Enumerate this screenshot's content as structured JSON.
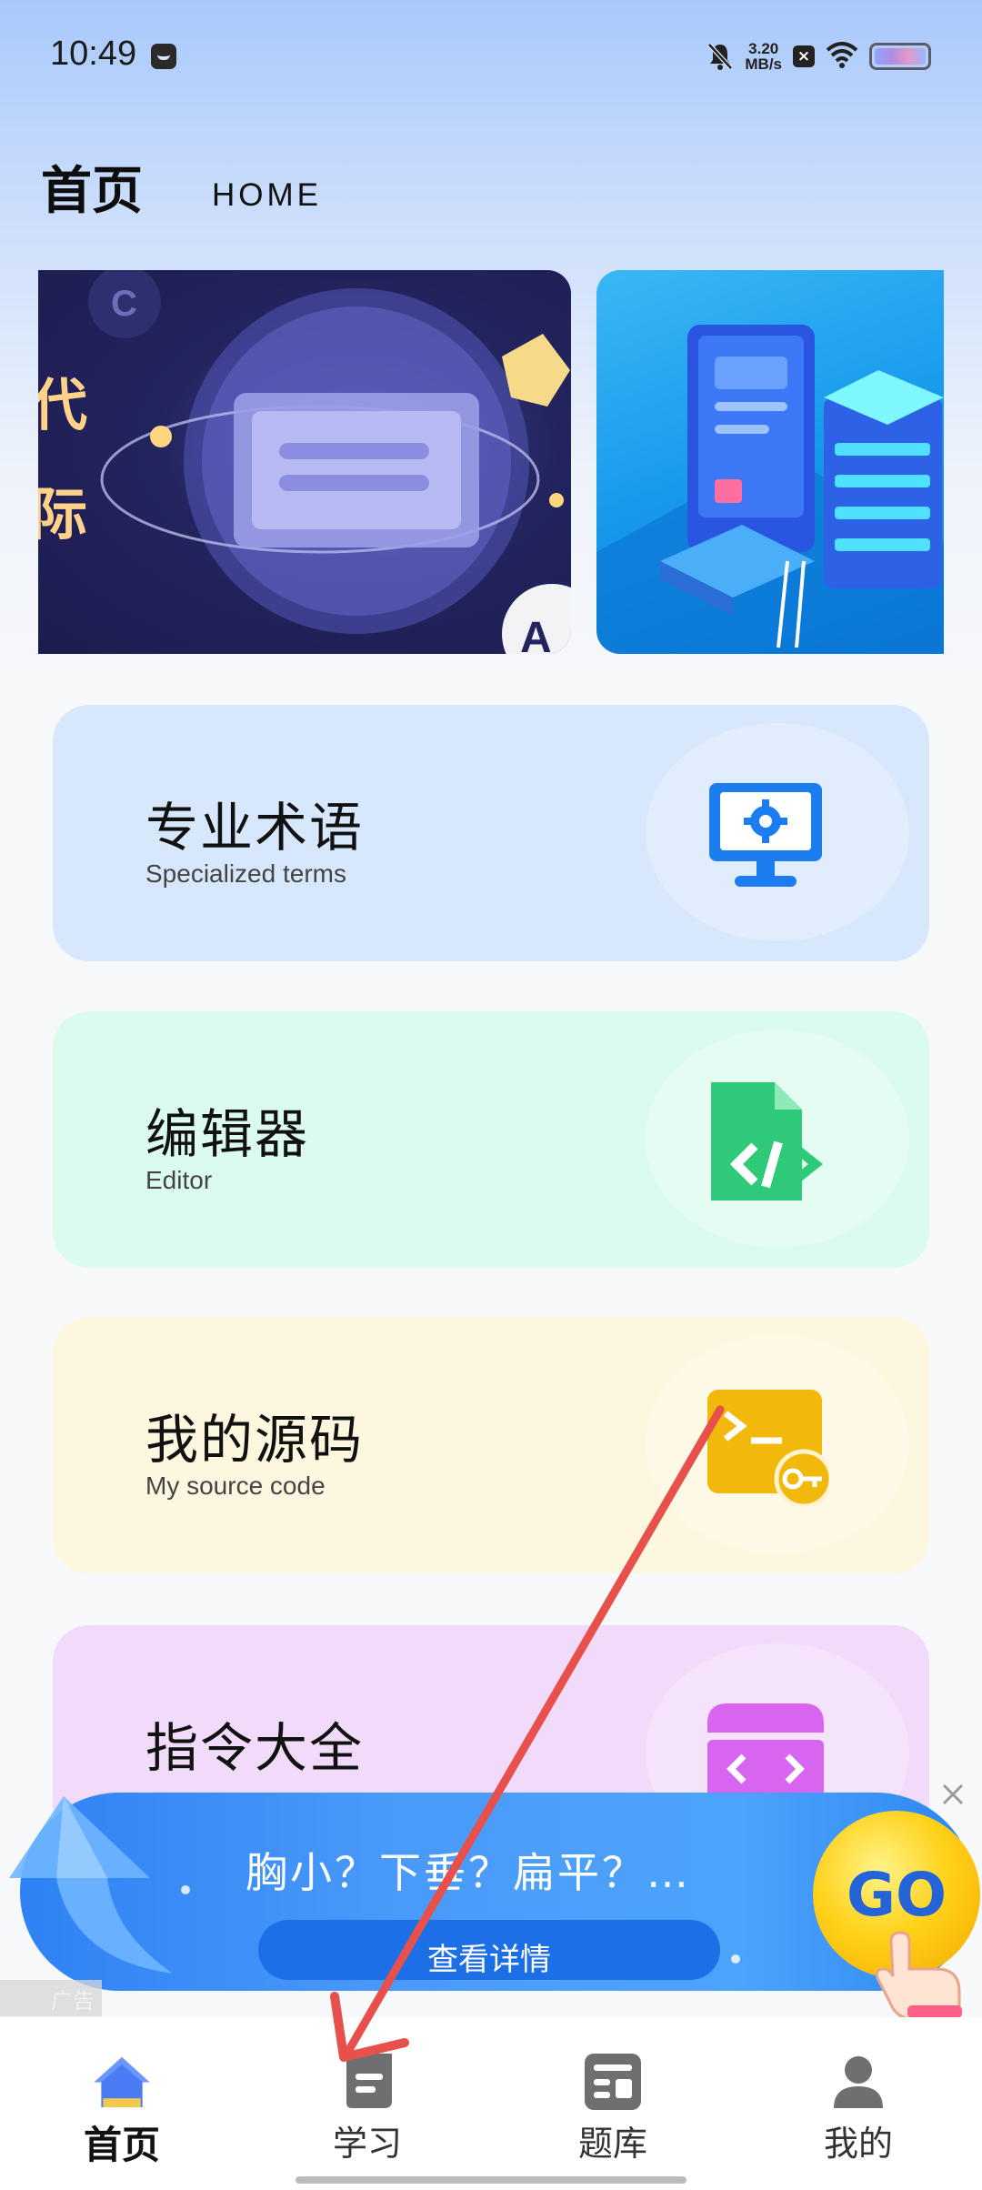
{
  "status_bar": {
    "time": "10:49",
    "net_speed_value": "3.20",
    "net_speed_unit": "MB/s",
    "x_badge": "×"
  },
  "header": {
    "title": "首页",
    "subtitle": "HOME"
  },
  "banners": {
    "left_text_1": "代",
    "left_text_2": "际",
    "left_corner_letter": "C",
    "left_badge": "A"
  },
  "cards": [
    {
      "title": "专业术语",
      "subtitle": "Specialized terms",
      "icon": "monitor-gear-icon",
      "color": "#d7e7fc"
    },
    {
      "title": "编辑器",
      "subtitle": "Editor",
      "icon": "code-file-icon",
      "color": "#dcfbef"
    },
    {
      "title": "我的源码",
      "subtitle": "My source code",
      "icon": "terminal-key-icon",
      "color": "#fef7df"
    },
    {
      "title": "指令大全",
      "subtitle": "",
      "icon": "command-list-icon",
      "color": "#f2dafb"
    }
  ],
  "ad": {
    "headline": "胸小？下垂？扁平？…",
    "button_label": "查看详情",
    "go_label": "GO",
    "tag_label": "广告"
  },
  "bottom_nav": {
    "items": [
      {
        "label": "首页",
        "icon": "home-icon",
        "active": true
      },
      {
        "label": "学习",
        "icon": "study-icon",
        "active": false
      },
      {
        "label": "题库",
        "icon": "question-bank-icon",
        "active": false
      },
      {
        "label": "我的",
        "icon": "profile-icon",
        "active": false
      }
    ]
  },
  "colors": {
    "accent_blue": "#2f82f4",
    "annotation_red": "#e8504b"
  }
}
